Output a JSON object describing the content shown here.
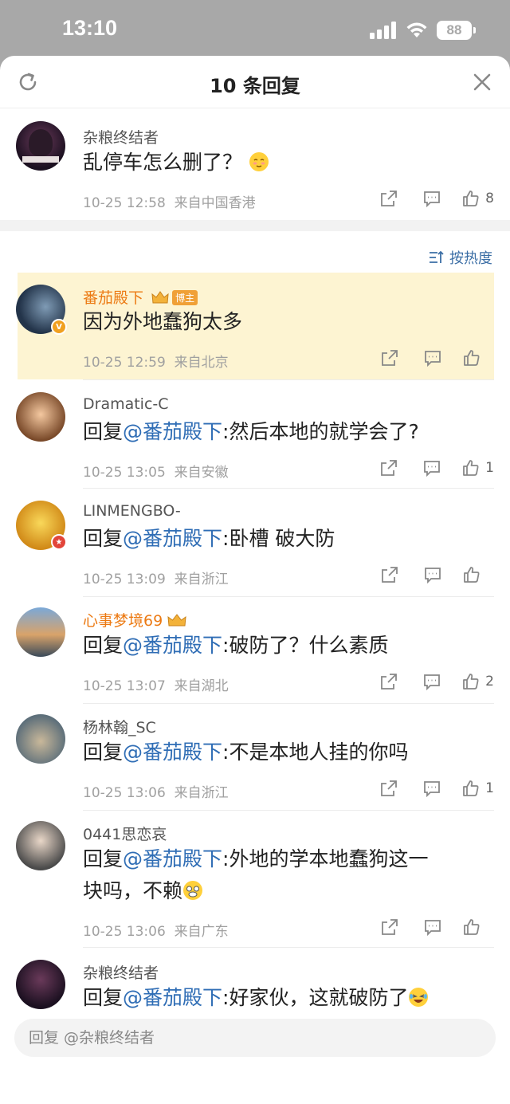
{
  "status": {
    "time": "13:10",
    "battery": "88"
  },
  "header": {
    "title": "10 条回复"
  },
  "original": {
    "username": "杂粮终结者",
    "text": "乱停车怎么删了？",
    "time": "10-25 12:58",
    "location": "来自中国香港",
    "likes": "8"
  },
  "sort": {
    "label": "按热度"
  },
  "replies": [
    {
      "username": "番茄殿下",
      "badge": "博主",
      "text": "因为外地蠢狗太多",
      "time": "10-25 12:59",
      "location": "来自北京",
      "likes": ""
    },
    {
      "username": "Dramatic-C",
      "prefix": "回复",
      "at": "@番茄殿下",
      "text": ":然后本地的就学会了?",
      "time": "10-25 13:05",
      "location": "来自安徽",
      "likes": "1"
    },
    {
      "username": "LINMENGBO-",
      "prefix": "回复",
      "at": "@番茄殿下",
      "text": ":卧槽 破大防",
      "time": "10-25 13:09",
      "location": "来自浙江",
      "likes": ""
    },
    {
      "username": "心事梦境69",
      "prefix": "回复",
      "at": "@番茄殿下",
      "text": ":破防了？什么素质",
      "time": "10-25 13:07",
      "location": "来自湖北",
      "likes": "2"
    },
    {
      "username": "杨林翰_SC",
      "prefix": "回复",
      "at": "@番茄殿下",
      "text": ":不是本地人挂的你吗",
      "time": "10-25 13:06",
      "location": "来自浙江",
      "likes": "1"
    },
    {
      "username": "0441思恋哀",
      "prefix": "回复",
      "at": "@番茄殿下",
      "text": ":外地的学本地蠢狗这一",
      "text2": "块吗，不赖",
      "time": "10-25 13:06",
      "location": "来自广东",
      "likes": ""
    },
    {
      "username": "杂粮终结者",
      "prefix": "回复",
      "at": "@番茄殿下",
      "text": ":好家伙，这就破防了",
      "time": "",
      "location": "",
      "likes": ""
    }
  ],
  "reply_input": {
    "placeholder": "回复 @杂粮终结者"
  },
  "colors": {
    "accent": "#2f6db5",
    "highlight": "#fdf4d2",
    "orange_name": "#ec7a13"
  }
}
